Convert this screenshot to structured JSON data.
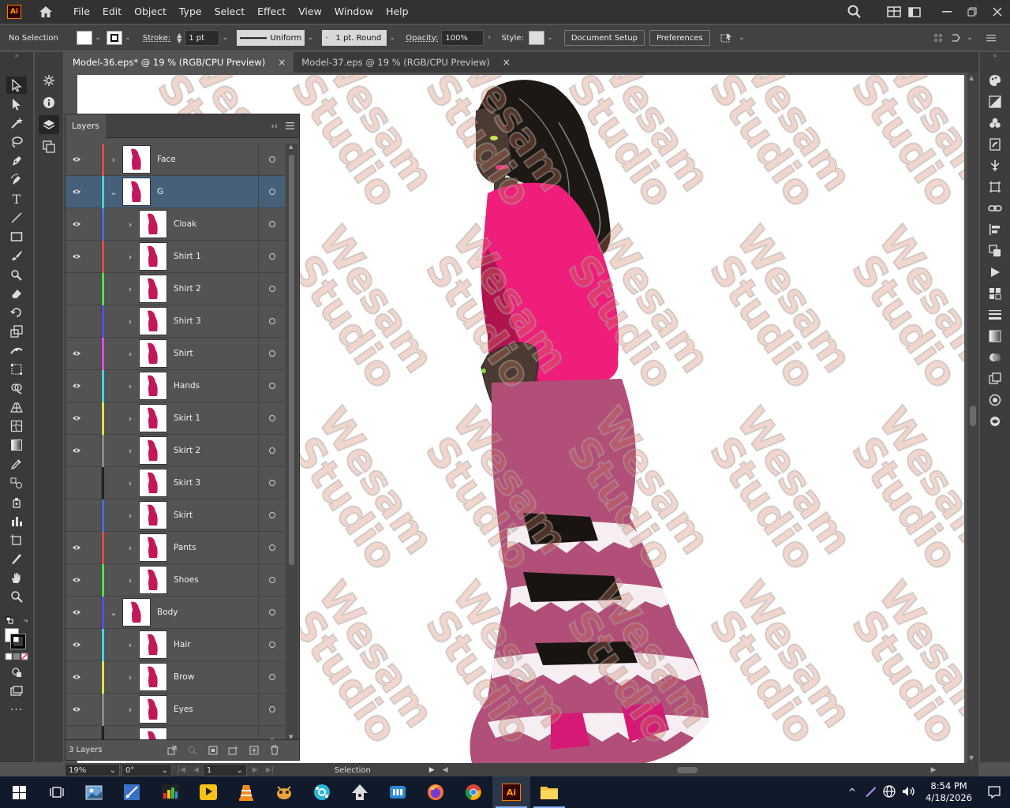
{
  "menubar": {
    "logo": "Ai",
    "items": [
      "File",
      "Edit",
      "Object",
      "Type",
      "Select",
      "Effect",
      "View",
      "Window",
      "Help"
    ]
  },
  "control": {
    "selection": "No Selection",
    "stroke_label": "Stroke:",
    "stroke_weight": "1 pt",
    "profile": "Uniform",
    "brush": "1 pt. Round",
    "opacity_label": "Opacity:",
    "opacity": "100%",
    "style_label": "Style:",
    "document_setup": "Document Setup",
    "preferences": "Preferences"
  },
  "tabs": [
    {
      "label": "Model-36.eps* @ 19 % (RGB/CPU Preview)",
      "close": "×"
    },
    {
      "label": "Model-37.eps @ 19 % (RGB/CPU Preview)",
      "close": "×"
    }
  ],
  "layers": {
    "title": "Layers",
    "count": "3 Layers",
    "rows": [
      {
        "name": "Face",
        "color": "#e14b4b",
        "level": 0,
        "expanded": false,
        "visible": true
      },
      {
        "name": "G",
        "color": "#4bd0d8",
        "level": 0,
        "expanded": true,
        "visible": true,
        "selected": true
      },
      {
        "name": "Cloak",
        "color": "#4b6be1",
        "level": 1,
        "expanded": false,
        "visible": true
      },
      {
        "name": "Shirt 1",
        "color": "#e14b4b",
        "level": 1,
        "expanded": false,
        "visible": true
      },
      {
        "name": "Shirt 2",
        "color": "#4be14b",
        "level": 1,
        "expanded": false,
        "visible": false
      },
      {
        "name": "Shirt 3",
        "color": "#5a4be1",
        "level": 1,
        "expanded": false,
        "visible": false
      },
      {
        "name": "Shirt",
        "color": "#e14be1",
        "level": 1,
        "expanded": false,
        "visible": true
      },
      {
        "name": "Hands",
        "color": "#4bd0d8",
        "level": 1,
        "expanded": false,
        "visible": true
      },
      {
        "name": "Skirt 1",
        "color": "#e1e14b",
        "level": 1,
        "expanded": false,
        "visible": true
      },
      {
        "name": "Skirt 2",
        "color": "#8a8a8a",
        "level": 1,
        "expanded": false,
        "visible": true
      },
      {
        "name": "Skirt 3",
        "color": "#222222",
        "level": 1,
        "expanded": false,
        "visible": false
      },
      {
        "name": "Skirt",
        "color": "#4b6be1",
        "level": 1,
        "expanded": false,
        "visible": false
      },
      {
        "name": "Pants",
        "color": "#e14b4b",
        "level": 1,
        "expanded": false,
        "visible": true
      },
      {
        "name": "Shoes",
        "color": "#4be14b",
        "level": 1,
        "expanded": false,
        "visible": true
      },
      {
        "name": "Body",
        "color": "#5a4be1",
        "level": 0,
        "expanded": true,
        "visible": true
      },
      {
        "name": "Hair",
        "color": "#4bd0d8",
        "level": 1,
        "expanded": false,
        "visible": true
      },
      {
        "name": "Brow",
        "color": "#e1e14b",
        "level": 1,
        "expanded": false,
        "visible": true
      },
      {
        "name": "Eyes",
        "color": "#8a8a8a",
        "level": 1,
        "expanded": false,
        "visible": true
      },
      {
        "name": "",
        "color": "#222222",
        "level": 1,
        "expanded": false,
        "visible": false
      }
    ]
  },
  "canvas": {
    "watermark_line1": "Wesam",
    "watermark_line2": "Studio"
  },
  "status": {
    "zoom": "19%",
    "rotation": "0°",
    "artboard": "1",
    "tool": "Selection"
  },
  "taskbar": {
    "time": "8:54 PM",
    "date": "4/18/2026"
  },
  "colors": {
    "shirt": "#ee1e7a",
    "shirt_shadow": "#b1134f",
    "skirt": "#b14f78",
    "skin": "#4a3a32",
    "hair": "#1e1814",
    "selection_row": "#46607a"
  }
}
